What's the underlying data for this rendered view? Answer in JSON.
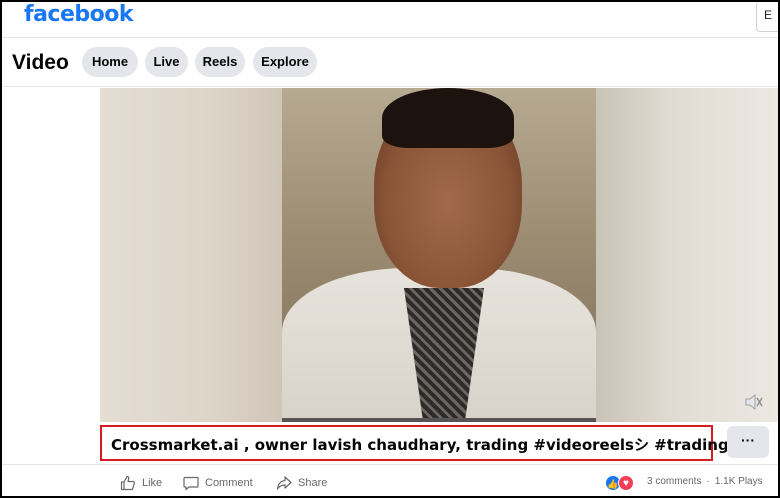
{
  "header": {
    "logo": "facebook",
    "top_right_button": "E"
  },
  "nav": {
    "page_title": "Video",
    "tabs": [
      {
        "label": "Home"
      },
      {
        "label": "Live"
      },
      {
        "label": "Reels"
      },
      {
        "label": "Explore"
      }
    ]
  },
  "video": {
    "caption": "Crossmarket.ai , owner lavish chaudhary, trading #videoreelsシ #trading",
    "more_label": "···"
  },
  "actions": {
    "like_label": "Like",
    "comment_label": "Comment",
    "share_label": "Share",
    "comments_count": "3 comments",
    "plays_count": "1.1K Plays",
    "stats_separator": "·"
  },
  "colors": {
    "brand": "#1877f2",
    "caption_border": "#d71920",
    "love": "#f33e58"
  },
  "icons": [
    "like-icon",
    "comment-icon",
    "share-icon",
    "volume-icon",
    "more-icon"
  ]
}
